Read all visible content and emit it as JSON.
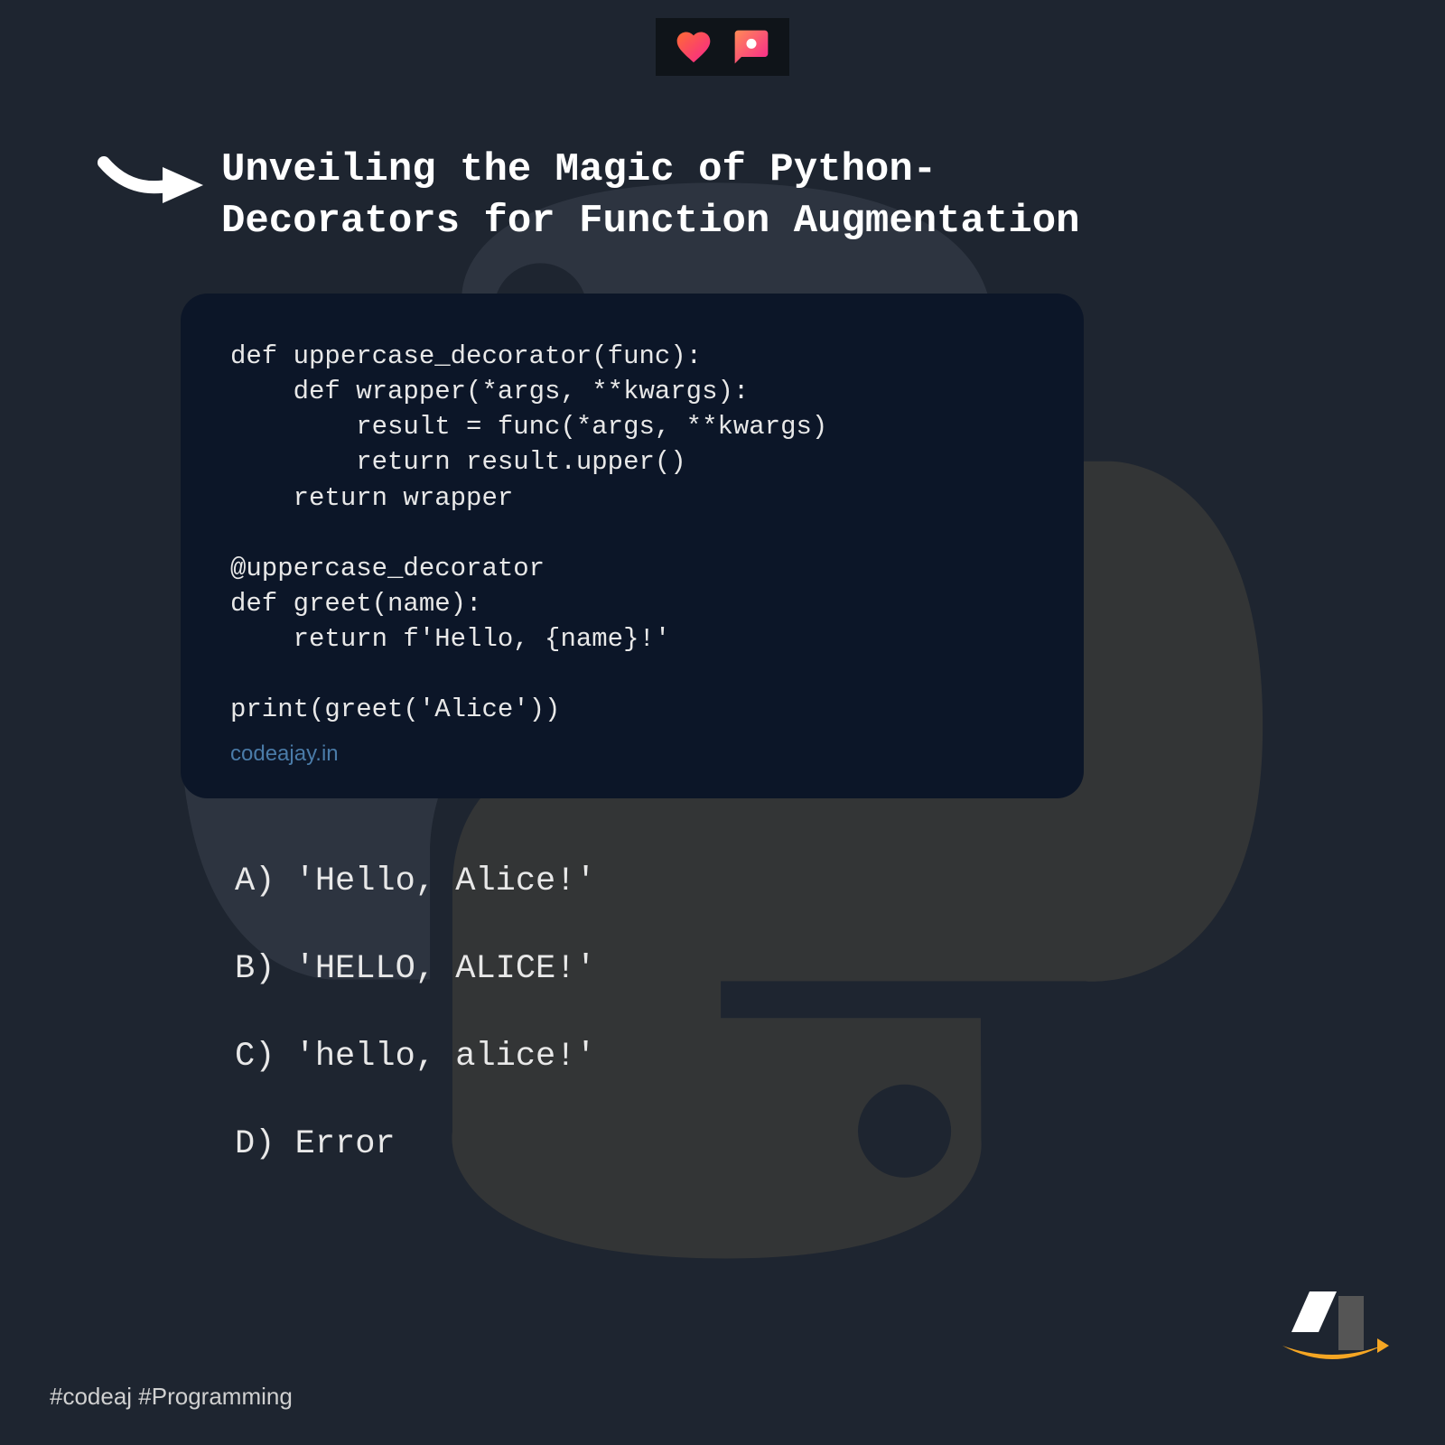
{
  "title_line1": "Unveiling the Magic of Python-",
  "title_line2": " Decorators for Function Augmentation",
  "code": "def uppercase_decorator(func):\n    def wrapper(*args, **kwargs):\n        result = func(*args, **kwargs)\n        return result.upper()\n    return wrapper\n\n@uppercase_decorator\ndef greet(name):\n    return f'Hello, {name}!'\n\nprint(greet('Alice'))",
  "watermark": "codeajay.in",
  "options": [
    "A) 'Hello, Alice!'",
    "B) 'HELLO, ALICE!'",
    "C) 'hello, alice!'",
    "D) Error"
  ],
  "hashtags": "#codeaj #Programming",
  "icons": {
    "heart": "heart-icon",
    "comment": "comment-icon",
    "arrow": "arrow-icon",
    "logo": "brand-logo"
  }
}
